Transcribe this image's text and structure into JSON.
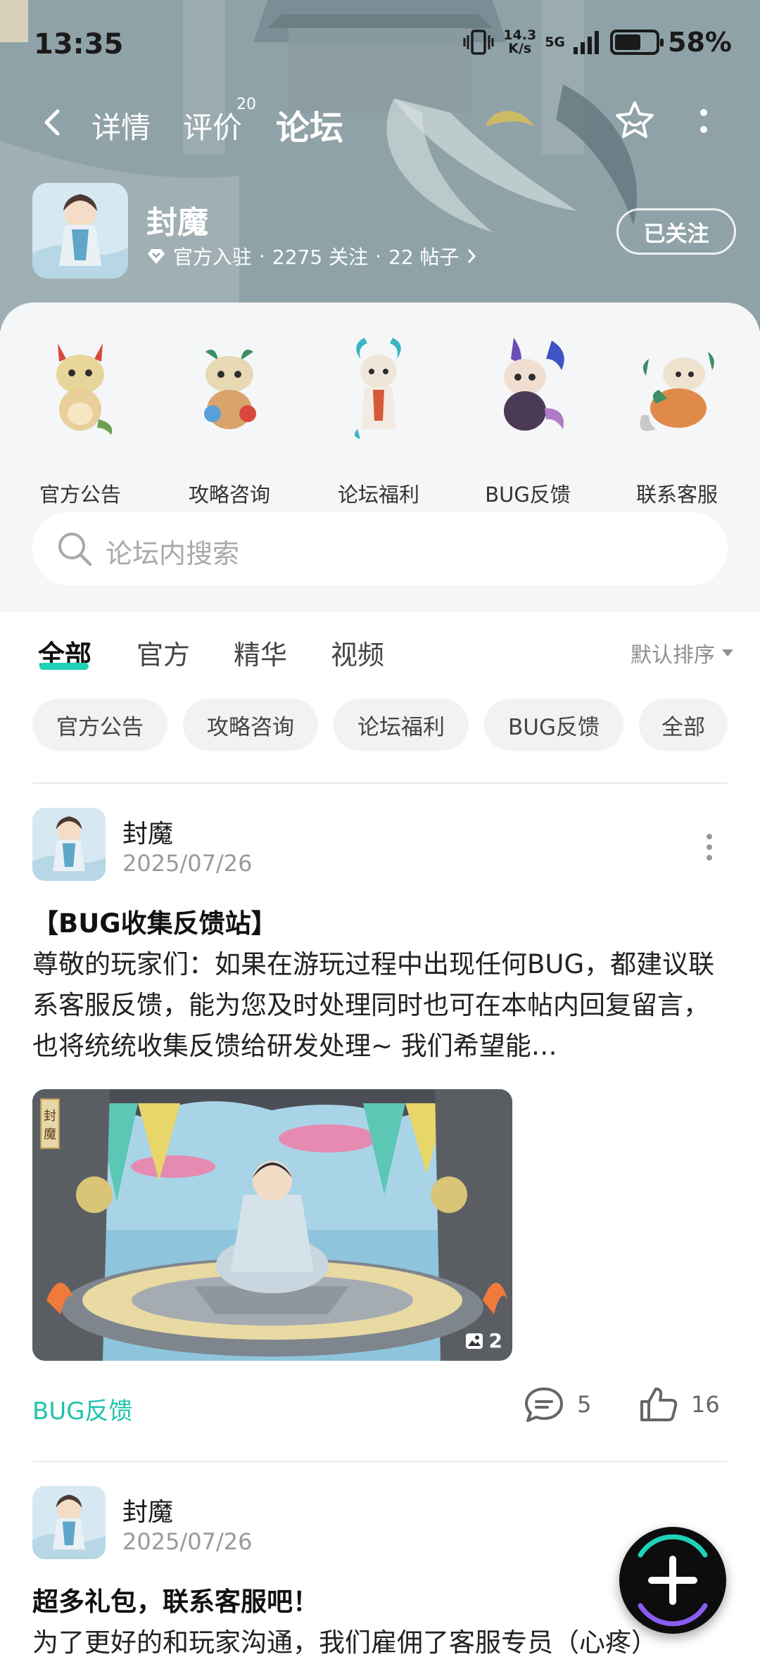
{
  "status_bar": {
    "time": "13:35",
    "net_speed_value": "14.3",
    "net_speed_unit": "K/s",
    "network": "5G",
    "battery_pct": "58%",
    "battery_level": 0.58
  },
  "nav": {
    "back_icon": "chevron-left-icon",
    "tabs": [
      {
        "label": "详情"
      },
      {
        "label": "评价",
        "badge": "20"
      },
      {
        "label": "论坛",
        "active": true
      }
    ],
    "star_icon": "star-badge-icon",
    "more_icon": "more-vertical-icon"
  },
  "game": {
    "title": "封魔",
    "meta_official": "官方入驻",
    "meta_follow": "2275 关注",
    "meta_posts": "22 帖子",
    "meta_sep": "·",
    "follow_label": "已关注"
  },
  "categories": [
    {
      "label": "官方公告"
    },
    {
      "label": "攻略咨询"
    },
    {
      "label": "论坛福利"
    },
    {
      "label": "BUG反馈"
    },
    {
      "label": "联系客服"
    }
  ],
  "search": {
    "placeholder": "论坛内搜索"
  },
  "filter_tabs": [
    {
      "label": "全部",
      "active": true
    },
    {
      "label": "官方"
    },
    {
      "label": "精华"
    },
    {
      "label": "视频"
    }
  ],
  "sort_label": "默认排序",
  "chips": [
    {
      "label": "官方公告"
    },
    {
      "label": "攻略咨询"
    },
    {
      "label": "论坛福利"
    },
    {
      "label": "BUG反馈"
    },
    {
      "label": "全部"
    }
  ],
  "posts": [
    {
      "author": "封魔",
      "date": "2025/07/26",
      "title": "【BUG收集反馈站】",
      "body": "尊敬的玩家们：如果在游玩过程中出现任何BUG，都建议联系客服反馈，能为您及时处理同时也可在本帖内回复留言，也将统统收集反馈给研发处理~ 我们希望能…",
      "image_count": "2",
      "image_seal_text": "封魔",
      "tag": "BUG反馈",
      "comments": "5",
      "likes": "16"
    },
    {
      "author": "封魔",
      "date": "2025/07/26",
      "title": "超多礼包，联系客服吧！",
      "body": "为了更好的和玩家沟通，我们雇佣了客服专员（心疼）"
    }
  ],
  "fab_icon": "plus-icon",
  "colors": {
    "accent": "#1fd1b6",
    "tag": "#1fc3aa"
  }
}
